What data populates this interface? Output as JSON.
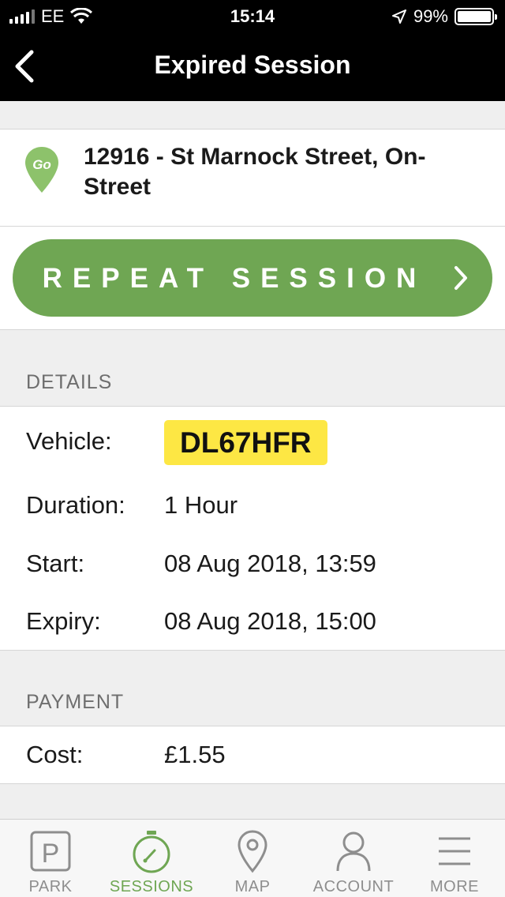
{
  "status_bar": {
    "carrier": "EE",
    "time": "15:14",
    "battery": "99%",
    "battery_level": 0.99
  },
  "nav": {
    "title": "Expired Session",
    "back_icon": "chevron-left-icon"
  },
  "location": {
    "name": "12916 - St Marnock Street, On-Street",
    "pin_icon": "go-location-pin-icon",
    "pin_text": "Go",
    "pin_color": "#8dc26b"
  },
  "repeat": {
    "label": "REPEAT SESSION",
    "color": "#6fa653"
  },
  "details": {
    "header": "DETAILS",
    "vehicle_label": "Vehicle:",
    "vehicle_value": "DL67HFR",
    "duration_label": "Duration:",
    "duration_value": "1 Hour",
    "start_label": "Start:",
    "start_value": "08 Aug 2018, 13:59",
    "expiry_label": "Expiry:",
    "expiry_value": "08 Aug 2018, 15:00",
    "plate_color": "#fde744"
  },
  "payment": {
    "header": "PAYMENT",
    "cost_label": "Cost:",
    "cost_value": "£1.55"
  },
  "tabs": [
    {
      "label": "PARK",
      "icon": "parking-icon",
      "active": false
    },
    {
      "label": "SESSIONS",
      "icon": "stopwatch-icon",
      "active": true
    },
    {
      "label": "MAP",
      "icon": "map-pin-icon",
      "active": false
    },
    {
      "label": "ACCOUNT",
      "icon": "person-icon",
      "active": false
    },
    {
      "label": "MORE",
      "icon": "hamburger-menu-icon",
      "active": false
    }
  ],
  "colors": {
    "accent": "#6fa653",
    "inactive": "#8e8e8e"
  }
}
